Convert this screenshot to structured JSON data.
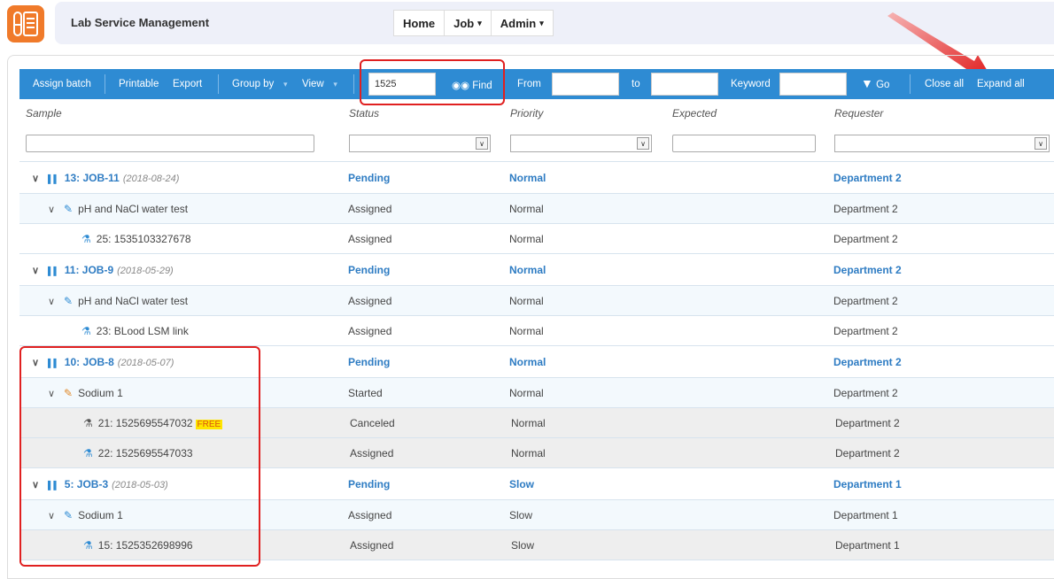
{
  "app": {
    "title": "Lab Service Management"
  },
  "nav": [
    {
      "label": "Home",
      "caret": ""
    },
    {
      "label": "Job",
      "caret": "▾"
    },
    {
      "label": "Admin",
      "caret": "▾"
    }
  ],
  "toolbar": {
    "assign_batch": "Assign batch",
    "printable": "Printable",
    "export": "Export",
    "group_by": "Group by",
    "view": "View",
    "find_value": "1525",
    "find": "Find",
    "from": "From",
    "to": "to",
    "keyword": "Keyword",
    "go": "Go",
    "close_all": "Close all",
    "expand_all": "Expand all"
  },
  "columns": {
    "sample": "Sample",
    "status": "Status",
    "priority": "Priority",
    "expected": "Expected",
    "requester": "Requester"
  },
  "rows": [
    {
      "kind": "job",
      "label": "13: JOB-11",
      "date": "(2018-08-24)",
      "status": "Pending",
      "priority": "Normal",
      "requester": "Department 2"
    },
    {
      "kind": "test",
      "label": "pH and NaCl water test",
      "status": "Assigned",
      "priority": "Normal",
      "requester": "Department 2"
    },
    {
      "kind": "sample",
      "label": "25: 1535103327678",
      "status": "Assigned",
      "priority": "Normal",
      "requester": "Department 2"
    },
    {
      "kind": "job",
      "label": "11: JOB-9",
      "date": "(2018-05-29)",
      "status": "Pending",
      "priority": "Normal",
      "requester": "Department 2"
    },
    {
      "kind": "test",
      "label": "pH and NaCl water test",
      "status": "Assigned",
      "priority": "Normal",
      "requester": "Department 2"
    },
    {
      "kind": "sample",
      "label": "23: BLood LSM link",
      "status": "Assigned",
      "priority": "Normal",
      "requester": "Department 2"
    },
    {
      "kind": "job",
      "label": "10: JOB-8",
      "date": "(2018-05-07)",
      "status": "Pending",
      "priority": "Normal",
      "requester": "Department 2"
    },
    {
      "kind": "test",
      "label": "Sodium 1",
      "status": "Started",
      "priority": "Normal",
      "requester": "Department 2"
    },
    {
      "kind": "sample",
      "label": "21: 1525695547032",
      "badge": "FREE",
      "status": "Canceled",
      "priority": "Normal",
      "requester": "Department 2"
    },
    {
      "kind": "sample",
      "label": "22: 1525695547033",
      "status": "Assigned",
      "priority": "Normal",
      "requester": "Department 2"
    },
    {
      "kind": "job",
      "label": "5: JOB-3",
      "date": "(2018-05-03)",
      "status": "Pending",
      "priority": "Slow",
      "requester": "Department 1"
    },
    {
      "kind": "test",
      "label": "Sodium 1",
      "status": "Assigned",
      "priority": "Slow",
      "requester": "Department 1"
    },
    {
      "kind": "sample",
      "label": "15: 1525352698996",
      "status": "Assigned",
      "priority": "Slow",
      "requester": "Department 1"
    }
  ],
  "colors": {
    "accent": "#2e8bd3",
    "highlight": "#e02020",
    "logo": "#f07a2a"
  }
}
